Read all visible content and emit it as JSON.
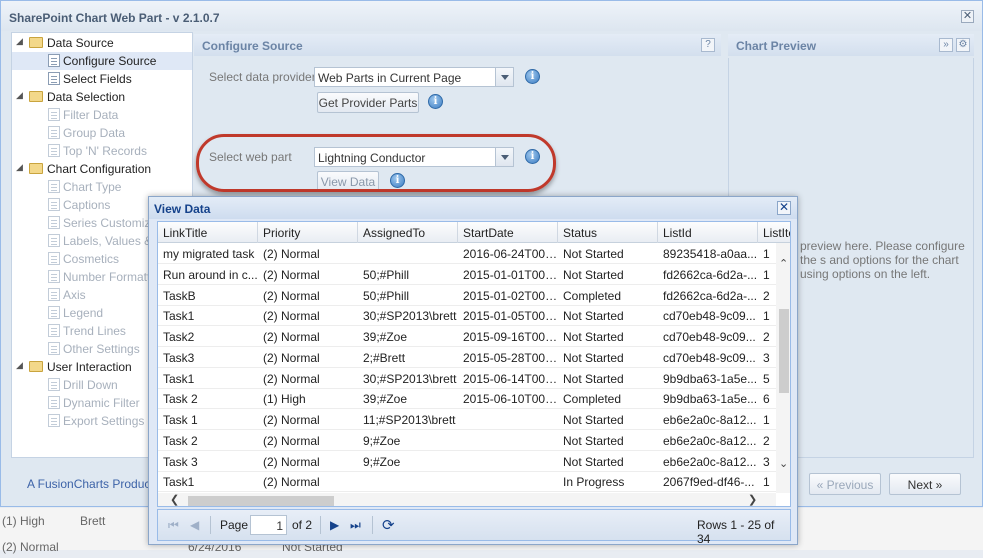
{
  "background_rows": [
    {
      "priority": "(1) High",
      "assigned": "Brett"
    },
    {
      "priority": "(2) Normal",
      "date": "6/24/2016",
      "status": "Not Started"
    }
  ],
  "dialog": {
    "title": "SharePoint Chart Web Part - v 2.1.0.7",
    "close": "✕"
  },
  "tree": [
    {
      "label": "Data Source",
      "type": "folder",
      "level": 0
    },
    {
      "label": "Configure Source",
      "type": "doc",
      "level": 1,
      "selected": true
    },
    {
      "label": "Select Fields",
      "type": "doc",
      "level": 1
    },
    {
      "label": "Data Selection",
      "type": "folder",
      "level": 0
    },
    {
      "label": "Filter Data",
      "type": "doc",
      "level": 1,
      "disabled": true
    },
    {
      "label": "Group Data",
      "type": "doc",
      "level": 1,
      "disabled": true
    },
    {
      "label": "Top 'N' Records",
      "type": "doc",
      "level": 1,
      "disabled": true
    },
    {
      "label": "Chart Configuration",
      "type": "folder",
      "level": 0
    },
    {
      "label": "Chart Type",
      "type": "doc",
      "level": 1,
      "disabled": true
    },
    {
      "label": "Captions",
      "type": "doc",
      "level": 1,
      "disabled": true
    },
    {
      "label": "Series Customiza",
      "type": "doc",
      "level": 1,
      "disabled": true
    },
    {
      "label": "Labels, Values &",
      "type": "doc",
      "level": 1,
      "disabled": true
    },
    {
      "label": "Cosmetics",
      "type": "doc",
      "level": 1,
      "disabled": true
    },
    {
      "label": "Number Formattin",
      "type": "doc",
      "level": 1,
      "disabled": true
    },
    {
      "label": "Axis",
      "type": "doc",
      "level": 1,
      "disabled": true
    },
    {
      "label": "Legend",
      "type": "doc",
      "level": 1,
      "disabled": true
    },
    {
      "label": "Trend Lines",
      "type": "doc",
      "level": 1,
      "disabled": true
    },
    {
      "label": "Other Settings",
      "type": "doc",
      "level": 1,
      "disabled": true
    },
    {
      "label": "User Interaction",
      "type": "folder",
      "level": 0
    },
    {
      "label": "Drill Down",
      "type": "doc",
      "level": 1,
      "disabled": true
    },
    {
      "label": "Dynamic Filter",
      "type": "doc",
      "level": 1,
      "disabled": true
    },
    {
      "label": "Export Settings",
      "type": "doc",
      "level": 1,
      "disabled": true
    }
  ],
  "configure": {
    "header": "Configure Source",
    "help": "?",
    "provider_label": "Select data provider",
    "provider_value": "Web Parts in Current Page",
    "get_parts_button": "Get Provider Parts",
    "webpart_label": "Select web part",
    "webpart_value": "Lightning Conductor",
    "view_data_button": "View Data",
    "info": "i"
  },
  "preview": {
    "header": "Chart Preview",
    "expand": "»",
    "gear": "⚙",
    "text": "preview here. Please configure the s and options for the chart using options on the left."
  },
  "footer": {
    "link": "A FusionCharts Product",
    "previous": "« Previous",
    "next": "Next »"
  },
  "view_data": {
    "title": "View Data",
    "close": "✕",
    "columns": [
      "LinkTitle",
      "Priority",
      "AssignedTo",
      "StartDate",
      "Status",
      "ListId",
      "ListIte"
    ],
    "rows": [
      [
        "my migrated task",
        "(2) Normal",
        "",
        "2016-06-24T00:...",
        "Not Started",
        "89235418-a0aa...",
        "1"
      ],
      [
        "Run around in c...",
        "(2) Normal",
        "50;#Phill",
        "2015-01-01T00:...",
        "Not Started",
        "fd2662ca-6d2a-...",
        "1"
      ],
      [
        "TaskB",
        "(2) Normal",
        "50;#Phill",
        "2015-01-02T00:...",
        "Completed",
        "fd2662ca-6d2a-...",
        "2"
      ],
      [
        "Task1",
        "(2) Normal",
        "30;#SP2013\\brett",
        "2015-01-05T00:...",
        "Not Started",
        "cd70eb48-9c09...",
        "1"
      ],
      [
        "Task2",
        "(2) Normal",
        "39;#Zoe",
        "2015-09-16T00:...",
        "Not Started",
        "cd70eb48-9c09...",
        "2"
      ],
      [
        "Task3",
        "(2) Normal",
        "2;#Brett",
        "2015-05-28T00:...",
        "Not Started",
        "cd70eb48-9c09...",
        "3"
      ],
      [
        "Task1",
        "(2) Normal",
        "30;#SP2013\\brett",
        "2015-06-14T00:...",
        "Not Started",
        "9b9dba63-1a5e...",
        "5"
      ],
      [
        "Task 2",
        "(1) High",
        "39;#Zoe",
        "2015-06-10T00:...",
        "Completed",
        "9b9dba63-1a5e...",
        "6"
      ],
      [
        "Task 1",
        "(2) Normal",
        "11;#SP2013\\brett",
        "",
        "Not Started",
        "eb6e2a0c-8a12...",
        "1"
      ],
      [
        "Task 2",
        "(2) Normal",
        "9;#Zoe",
        "",
        "Not Started",
        "eb6e2a0c-8a12...",
        "2"
      ],
      [
        "Task 3",
        "(2) Normal",
        "9;#Zoe",
        "",
        "Not Started",
        "eb6e2a0c-8a12...",
        "3"
      ],
      [
        "Task1",
        "(2) Normal",
        "",
        "",
        "In Progress",
        "2067f9ed-df46-...",
        "1"
      ]
    ],
    "pager": {
      "first": "⏮",
      "prev": "◀",
      "page_label": "Page",
      "page_value": "1",
      "of_label": "of 2",
      "next": "▶",
      "last": "⏭",
      "refresh": "⟳",
      "rows_info": "Rows 1 - 25 of 34"
    }
  }
}
